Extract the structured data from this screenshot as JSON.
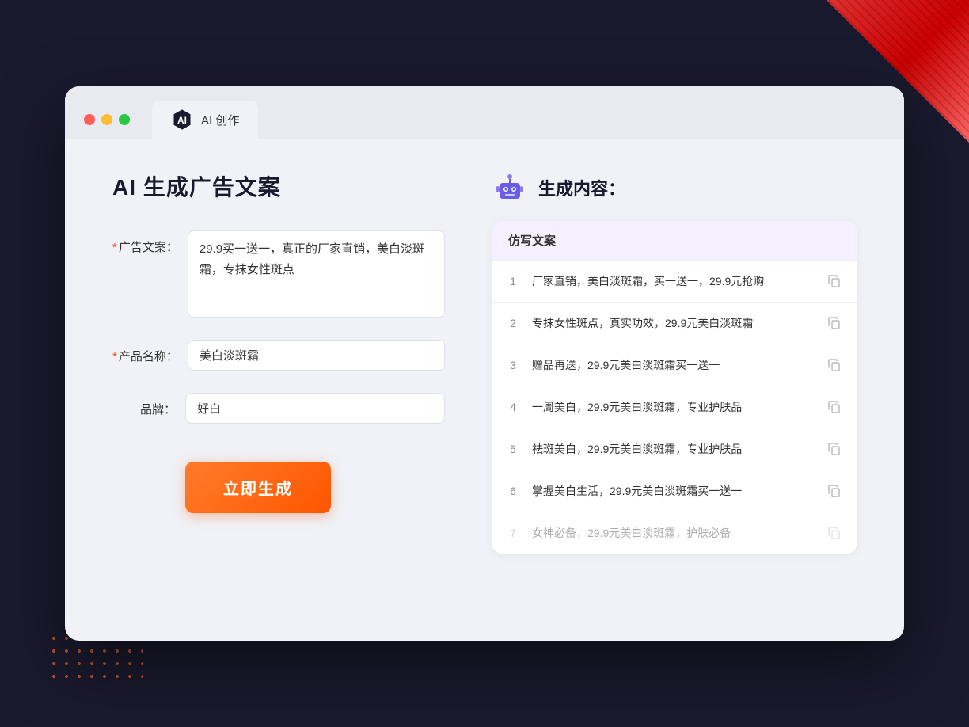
{
  "background": {
    "triangle_color": "#cc0000"
  },
  "browser": {
    "tab_title": "AI 创作",
    "tab_icon": "ai-hexagon-icon"
  },
  "page": {
    "title": "AI 生成广告文案"
  },
  "form": {
    "ad_copy_label": "广告文案：",
    "ad_copy_required": "*",
    "ad_copy_value": "29.9买一送一，真正的厂家直销，美白淡斑霜，专抹女性斑点",
    "product_name_label": "产品名称：",
    "product_name_required": "*",
    "product_name_value": "美白淡斑霜",
    "brand_label": "品牌：",
    "brand_value": "好白",
    "generate_button_label": "立即生成"
  },
  "result": {
    "header_title": "生成内容：",
    "table_header": "仿写文案",
    "items": [
      {
        "num": "1",
        "text": "厂家直销，美白淡斑霜，买一送一，29.9元抢购",
        "faded": false
      },
      {
        "num": "2",
        "text": "专抹女性斑点，真实功效，29.9元美白淡斑霜",
        "faded": false
      },
      {
        "num": "3",
        "text": "赠品再送，29.9元美白淡斑霜买一送一",
        "faded": false
      },
      {
        "num": "4",
        "text": "一周美白，29.9元美白淡斑霜，专业护肤品",
        "faded": false
      },
      {
        "num": "5",
        "text": "祛斑美白，29.9元美白淡斑霜，专业护肤品",
        "faded": false
      },
      {
        "num": "6",
        "text": "掌握美白生活，29.9元美白淡斑霜买一送一",
        "faded": false
      },
      {
        "num": "7",
        "text": "女神必备，29.9元美白淡斑霜，护肤必备",
        "faded": true
      }
    ]
  }
}
